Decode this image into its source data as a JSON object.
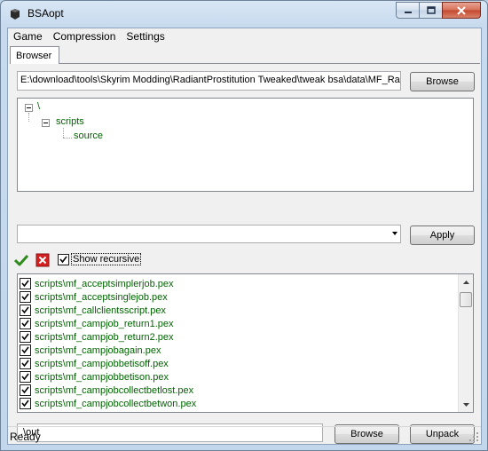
{
  "window": {
    "title": "BSAopt",
    "icon": "app-icon"
  },
  "menu": [
    "Game",
    "Compression",
    "Settings"
  ],
  "tabs": [
    "Browser"
  ],
  "browser": {
    "path_value": "E:\\download\\tools\\Skyrim Modding\\RadiantProstitution Tweaked\\tweak bsa\\data\\MF_Rad",
    "browse_label": "Browse",
    "tree": [
      {
        "label": "\\",
        "expanded": true
      },
      {
        "label": "scripts",
        "expanded": true
      },
      {
        "label": "source"
      }
    ],
    "filter_value": "",
    "apply_label": "Apply",
    "show_recursive_label": "Show recursive",
    "show_recursive_checked": true,
    "files": [
      {
        "name": "scripts\\mf_acceptsimplerjob.pex",
        "checked": true
      },
      {
        "name": "scripts\\mf_acceptsinglejob.pex",
        "checked": true
      },
      {
        "name": "scripts\\mf_callclientsscript.pex",
        "checked": true
      },
      {
        "name": "scripts\\mf_campjob_return1.pex",
        "checked": true
      },
      {
        "name": "scripts\\mf_campjob_return2.pex",
        "checked": true
      },
      {
        "name": "scripts\\mf_campjobagain.pex",
        "checked": true
      },
      {
        "name": "scripts\\mf_campjobbetisoff.pex",
        "checked": true
      },
      {
        "name": "scripts\\mf_campjobbetison.pex",
        "checked": true
      },
      {
        "name": "scripts\\mf_campjobcollectbetlost.pex",
        "checked": true
      },
      {
        "name": "scripts\\mf_campjobcollectbetwon.pex",
        "checked": true
      }
    ],
    "output_value": ".\\out",
    "browse_output_label": "Browse",
    "unpack_label": "Unpack"
  },
  "status": "Ready",
  "colors": {
    "tree_text": "#006400",
    "accent": "#bcd3ea"
  }
}
